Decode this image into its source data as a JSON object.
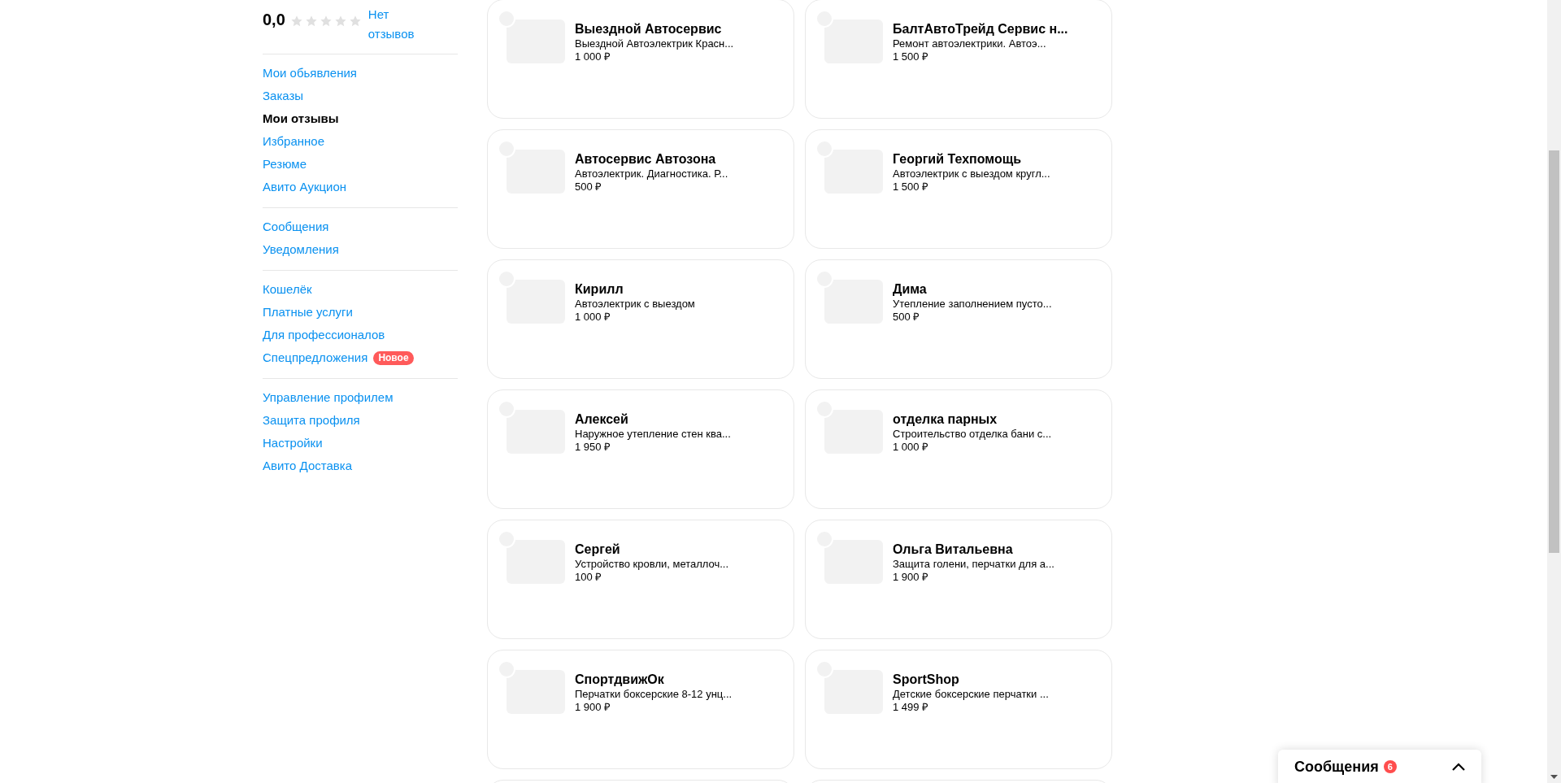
{
  "rating": {
    "score": "0,0",
    "stars": 0,
    "reviews_link": "Нет отзывов"
  },
  "sidebar": {
    "groups": [
      {
        "items": [
          {
            "label": "Мои обьявления",
            "selected": false
          },
          {
            "label": "Заказы",
            "selected": false
          },
          {
            "label": "Мои отзывы",
            "selected": true
          },
          {
            "label": "Избранное",
            "selected": false
          },
          {
            "label": "Резюме",
            "selected": false
          },
          {
            "label": "Авито Аукцион",
            "selected": false
          }
        ]
      },
      {
        "items": [
          {
            "label": "Сообщения",
            "selected": false
          },
          {
            "label": "Уведомления",
            "selected": false
          }
        ]
      },
      {
        "items": [
          {
            "label": "Кошелёк",
            "selected": false
          },
          {
            "label": "Платные услуги",
            "selected": false
          },
          {
            "label": "Для профессионалов",
            "selected": false
          },
          {
            "label": "Спецпредложения",
            "selected": false,
            "badge": "Новое"
          }
        ]
      },
      {
        "items": [
          {
            "label": "Управление профилем",
            "selected": false
          },
          {
            "label": "Защита профиля",
            "selected": false
          },
          {
            "label": "Настройки",
            "selected": false
          },
          {
            "label": "Авито Доставка",
            "selected": false
          }
        ]
      }
    ]
  },
  "listings": [
    {
      "kind": "full",
      "title": "Выездной Автосервис",
      "description": "Выездной Автоэлектрик Красн...",
      "price": "1 000 ₽"
    },
    {
      "kind": "full",
      "title": "БалтАвтоТрейд Сервис н...",
      "description": "Ремонт автоэлектрики. Автоэ...",
      "price": "1 500 ₽"
    },
    {
      "kind": "full",
      "title": "Автосервис Автозона",
      "description": "Автоэлектрик. Диагностика. Р...",
      "price": "500 ₽"
    },
    {
      "kind": "full",
      "title": "Георгий Техпомощь",
      "description": "Автоэлектрик с выездом кругл...",
      "price": "1 500 ₽"
    },
    {
      "kind": "full",
      "title": "Кирилл",
      "description": "Автоэлектрик с выездом",
      "price": "1 000 ₽"
    },
    {
      "kind": "full",
      "title": "Дима",
      "description": "Утепление заполнением пусто...",
      "price": "500 ₽"
    },
    {
      "kind": "full",
      "title": "Алексей",
      "description": "Наружное утепление стен ква...",
      "price": "1 950 ₽"
    },
    {
      "kind": "full",
      "title": "отделка парных",
      "description": "Строительство отделка бани с...",
      "price": "1 000 ₽"
    },
    {
      "kind": "full",
      "title": "Сергей",
      "description": "Устройство кровли, металлоч...",
      "price": "100 ₽"
    },
    {
      "kind": "full",
      "title": "Ольга Витальевна",
      "description": "Защита голени, перчатки для а...",
      "price": "1 900 ₽"
    },
    {
      "kind": "full",
      "title": "СпортдвижОк",
      "description": "Перчатки боксерские 8-12 унц...",
      "price": "1 900 ₽"
    },
    {
      "kind": "full",
      "title": "SportShop",
      "description": "Детские боксерские перчатки ...",
      "price": "1 499 ₽"
    },
    {
      "kind": "partial"
    },
    {
      "kind": "partial"
    }
  ],
  "messages_widget": {
    "title": "Сообщения",
    "count": "6",
    "expanded": false
  }
}
